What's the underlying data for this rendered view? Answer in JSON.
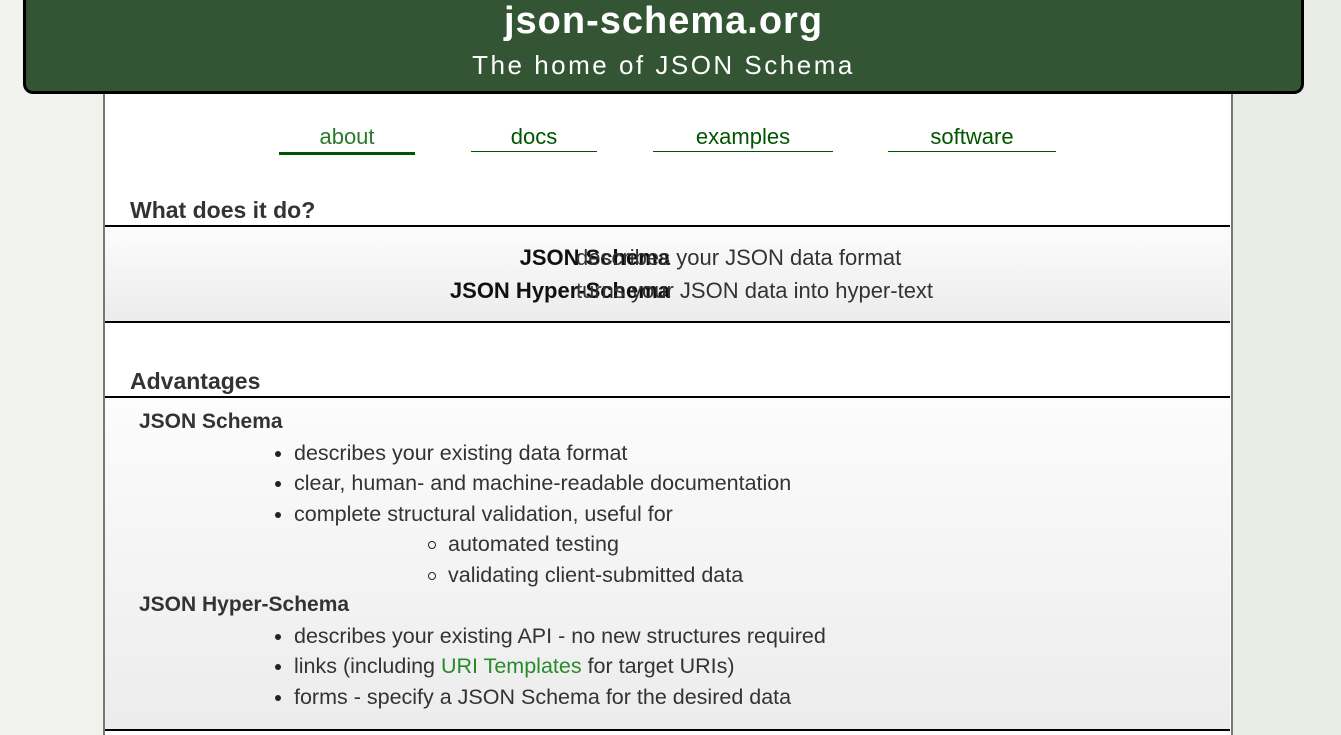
{
  "header": {
    "title": "json-schema.org",
    "subtitle": "The home of JSON Schema"
  },
  "nav": {
    "items": [
      {
        "label": "about",
        "active": true
      },
      {
        "label": "docs",
        "active": false
      },
      {
        "label": "examples",
        "active": false
      },
      {
        "label": "software",
        "active": false
      }
    ]
  },
  "what_section": {
    "heading": "What does it do?",
    "rows": [
      {
        "name": "JSON Schema",
        "desc": "describes your JSON data format"
      },
      {
        "name": "JSON Hyper-Schema",
        "desc": "turns your JSON data into hyper-text"
      }
    ]
  },
  "advantages": {
    "heading": "Advantages",
    "schema": {
      "title": "JSON Schema",
      "bullets": [
        "describes your existing data format",
        "clear, human- and machine-readable documentation",
        "complete structural validation, useful for"
      ],
      "sub_bullets": [
        "automated testing",
        "validating client-submitted data"
      ]
    },
    "hyper_schema": {
      "title": "JSON Hyper-Schema",
      "bullets": [
        "describes your existing API - no new structures required",
        "forms - specify a JSON Schema for the desired data"
      ],
      "links_bullet": {
        "before": "links (including ",
        "link": "URI Templates",
        "after": " for target URIs)"
      }
    }
  },
  "colors": {
    "header_bg": "#335533",
    "nav_link": "#005500",
    "inline_link": "#2a8a2a"
  }
}
